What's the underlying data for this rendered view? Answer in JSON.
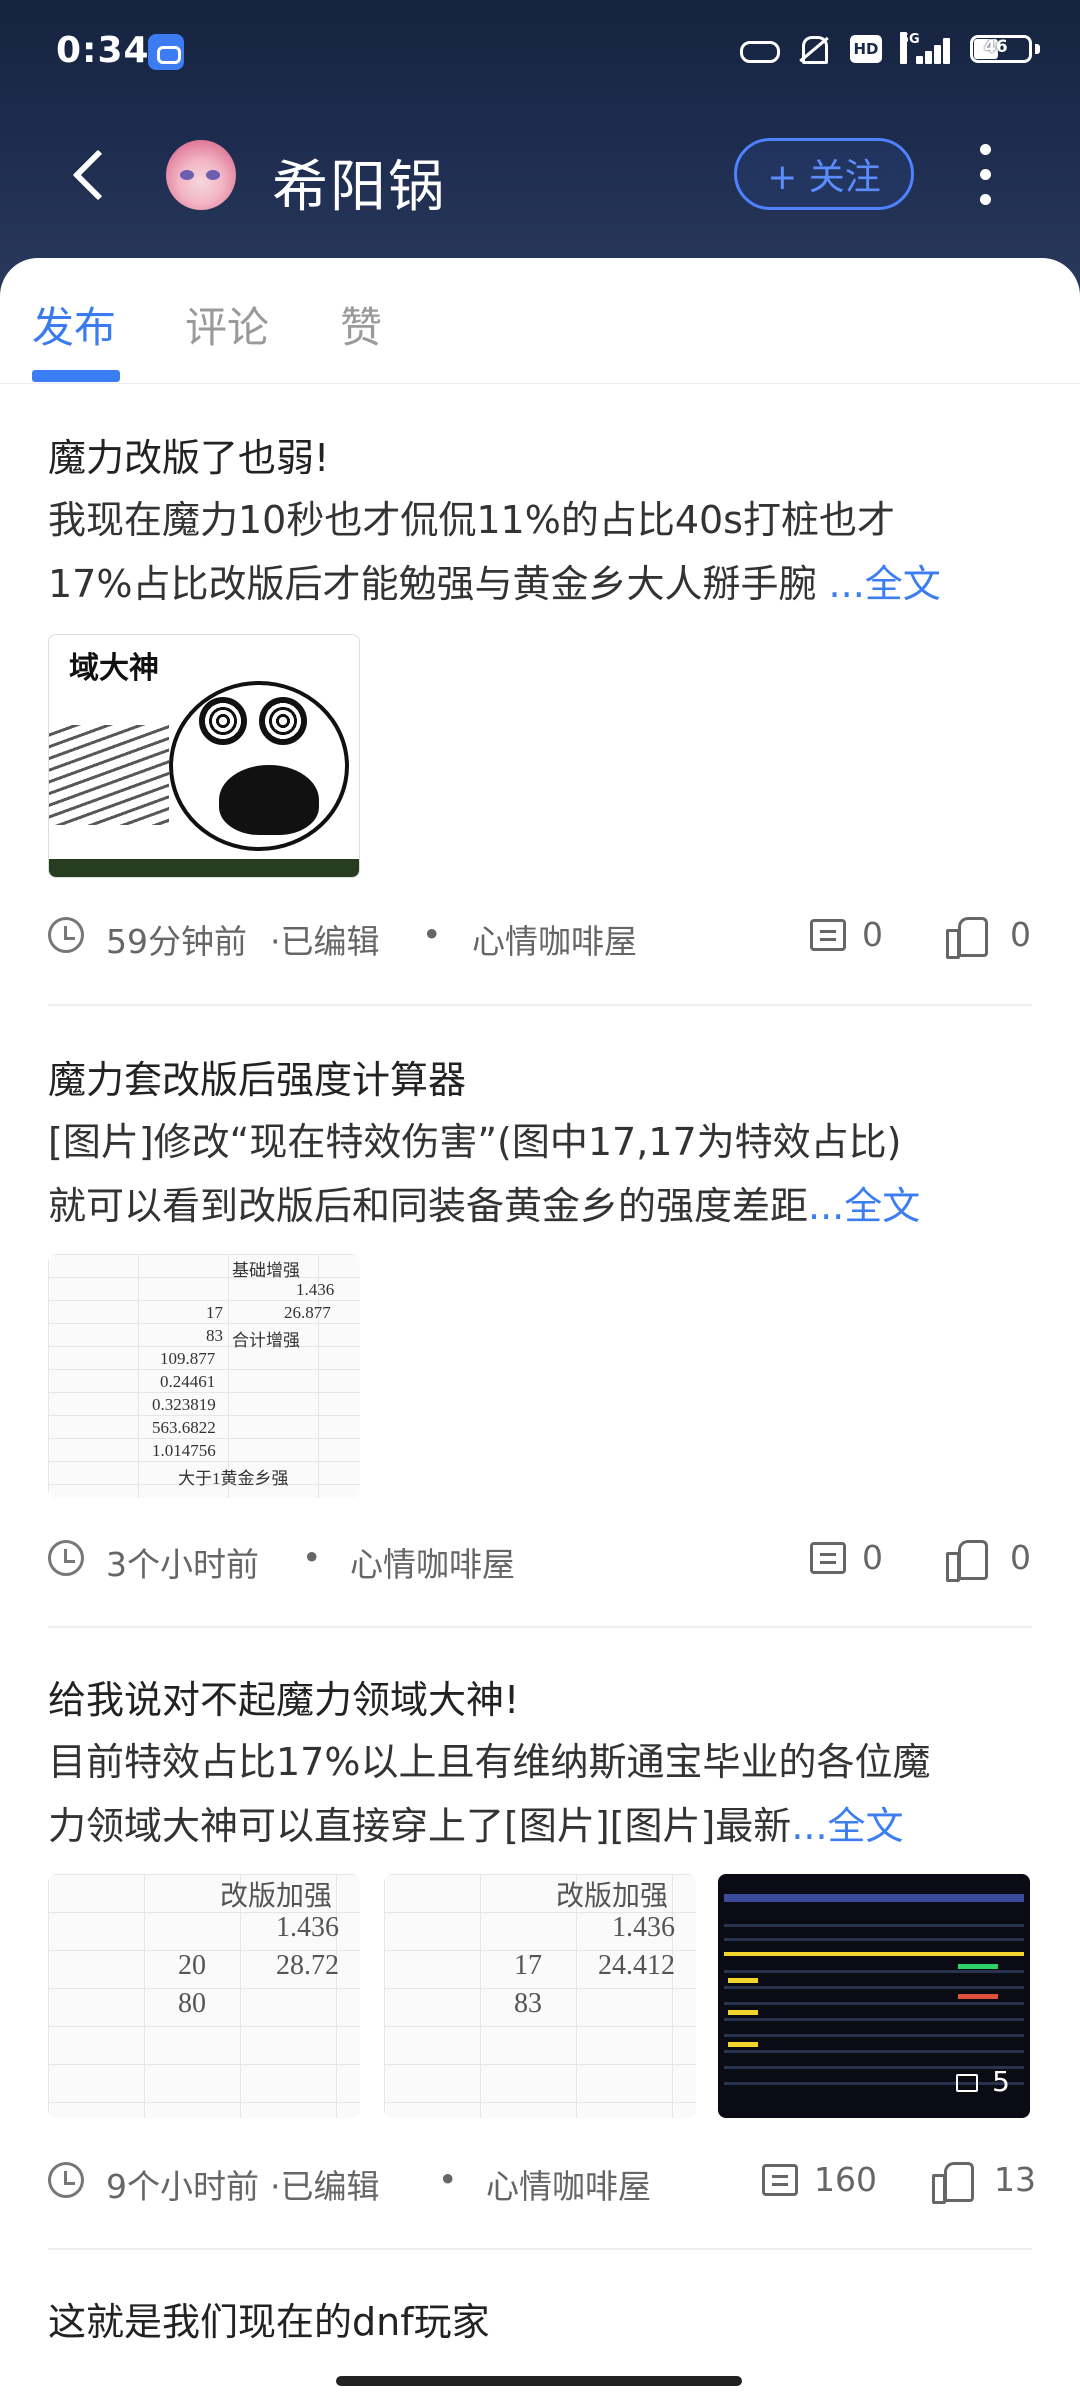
{
  "status_bar": {
    "time": "0:34",
    "network": "5G",
    "battery": "46"
  },
  "header": {
    "username": "希阳锅",
    "follow_label": "+ 关注"
  },
  "tabs": [
    {
      "label": "发布",
      "active": true
    },
    {
      "label": "评论",
      "active": false
    },
    {
      "label": "赞",
      "active": false
    }
  ],
  "posts": [
    {
      "title": "魔力改版了也弱!",
      "body_line1": " 我现在魔力10秒也才侃侃11%的占比40s打桩也才",
      "body_line2": "17%占比改版后才能勉强与黄金乡大人掰手腕 ",
      "more": "...全文",
      "image_label": "域大神",
      "time": "59分钟前",
      "edited": "·已编辑",
      "separator": "•",
      "circle": "心情咖啡屋",
      "comments": "0",
      "likes": "0"
    },
    {
      "title": "魔力套改版后强度计算器",
      "body_line1": "[图片]修改“现在特效伤害”(图中17,17为特效占比)",
      "body_line2": "就可以看到改版后和同装备黄金乡的强度差距",
      "more": "...全文",
      "sheet_cells": [
        "基础增强",
        "1.436",
        "17",
        "26.877",
        "83",
        "合计增强",
        "109.877",
        "0.24461",
        "0.323819",
        "563.6822",
        "1.014756",
        "大于1黄金乡强"
      ],
      "time": "3个小时前",
      "separator": "•",
      "circle": "心情咖啡屋",
      "comments": "0",
      "likes": "0"
    },
    {
      "title": "给我说对不起魔力领域大神!",
      "body_line1": " 目前特效占比17%以上且有维纳斯通宝毕业的各位魔",
      "body_line2": "力领域大神可以直接穿上了[图片][图片]最新",
      "more": "...全文",
      "sheet_a": [
        "改版加强",
        "1.436",
        "20",
        "28.72",
        "80"
      ],
      "sheet_b": [
        "改版加强",
        "1.436",
        "17",
        "24.412",
        "83"
      ],
      "image_count": "5",
      "time": "9个小时前",
      "edited": "·已编辑",
      "separator": "•",
      "circle": "心情咖啡屋",
      "comments": "160",
      "likes": "13"
    },
    {
      "title": "这就是我们现在的dnf玩家"
    }
  ]
}
